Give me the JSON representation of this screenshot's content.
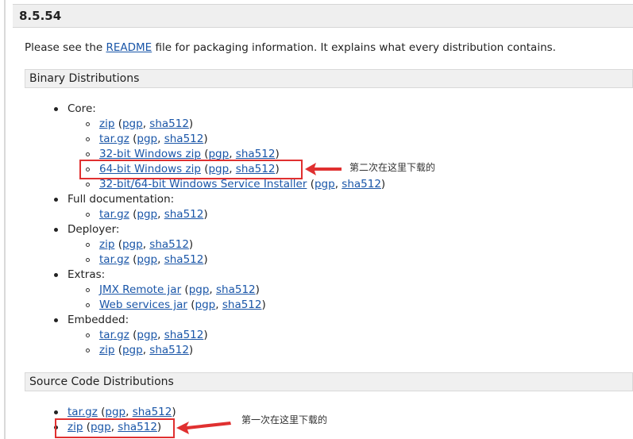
{
  "version": "8.5.54",
  "intro": {
    "before": "Please see the ",
    "link": "README",
    "after": " file for packaging information. It explains what every distribution contains."
  },
  "binary": {
    "title": "Binary Distributions",
    "core": {
      "label": "Core:",
      "items": [
        {
          "name": "zip",
          "pgp": "pgp",
          "sha": "sha512"
        },
        {
          "name": "tar.gz",
          "pgp": "pgp",
          "sha": "sha512"
        },
        {
          "name": "32-bit Windows zip",
          "pgp": "pgp",
          "sha": "sha512"
        },
        {
          "name": "64-bit Windows zip",
          "pgp": "pgp",
          "sha": "sha512"
        },
        {
          "name": "32-bit/64-bit Windows Service Installer",
          "pgp": "pgp",
          "sha": "sha512"
        }
      ]
    },
    "fulldoc": {
      "label": "Full documentation:",
      "items": [
        {
          "name": "tar.gz",
          "pgp": "pgp",
          "sha": "sha512"
        }
      ]
    },
    "deployer": {
      "label": "Deployer:",
      "items": [
        {
          "name": "zip",
          "pgp": "pgp",
          "sha": "sha512"
        },
        {
          "name": "tar.gz",
          "pgp": "pgp",
          "sha": "sha512"
        }
      ]
    },
    "extras": {
      "label": "Extras:",
      "items": [
        {
          "name": "JMX Remote jar",
          "pgp": "pgp",
          "sha": "sha512"
        },
        {
          "name": "Web services jar",
          "pgp": "pgp",
          "sha": "sha512"
        }
      ]
    },
    "embedded": {
      "label": "Embedded:",
      "items": [
        {
          "name": "tar.gz",
          "pgp": "pgp",
          "sha": "sha512"
        },
        {
          "name": "zip",
          "pgp": "pgp",
          "sha": "sha512"
        }
      ]
    }
  },
  "source": {
    "title": "Source Code Distributions",
    "items": [
      {
        "name": "tar.gz",
        "pgp": "pgp",
        "sha": "sha512"
      },
      {
        "name": "zip",
        "pgp": "pgp",
        "sha": "sha512"
      }
    ]
  },
  "annotations": {
    "second": "第二次在这里下载的",
    "first": "第一次在这里下载的",
    "color": "#e03030"
  },
  "colors": {
    "link": "#1a56a8",
    "header_bg": "#efefef"
  }
}
